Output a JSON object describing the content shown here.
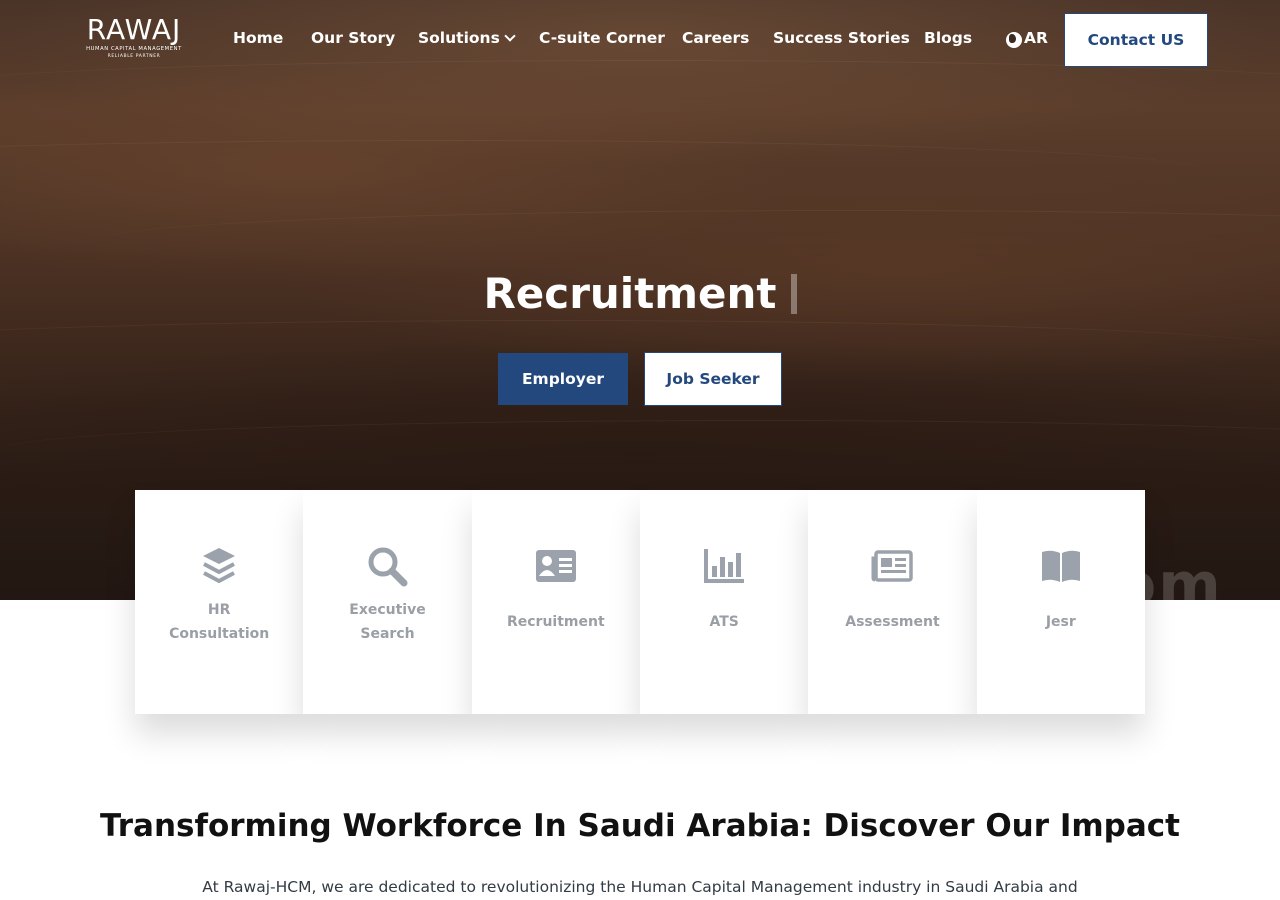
{
  "brand": {
    "name": "RAWAJ",
    "subtitle": "HUMAN CAPITAL MANAGEMENT",
    "tagline": "RELIABLE PARTNER"
  },
  "nav": {
    "items": [
      "Home",
      "Our Story",
      "Solutions",
      "C-suite Corner",
      "Careers",
      "Success Stories",
      "Blogs"
    ],
    "language": "AR",
    "contact": "Contact US"
  },
  "hero": {
    "title": "Recruitment",
    "employer_button": "Employer",
    "jobseeker_button": "Job Seeker",
    "watermark": "om"
  },
  "services": [
    {
      "label_line1": "HR",
      "label_line2": "Consultation",
      "icon": "layers-icon"
    },
    {
      "label_line1": "Executive",
      "label_line2": "Search",
      "icon": "search-icon"
    },
    {
      "label": "Recruitment",
      "icon": "id-card-icon"
    },
    {
      "label": "ATS",
      "icon": "bar-chart-icon"
    },
    {
      "label": "Assessment",
      "icon": "newspaper-icon"
    },
    {
      "label": "Jesr",
      "icon": "book-icon"
    }
  ],
  "impact": {
    "title": "Transforming Workforce In Saudi Arabia: Discover Our Impact",
    "text": "At Rawaj-HCM, we are dedicated to revolutionizing the Human Capital Management industry in Saudi Arabia and"
  },
  "colors": {
    "primary": "#23487e",
    "card_text": "#9a9fa6",
    "icon": "#9ba2ab"
  }
}
